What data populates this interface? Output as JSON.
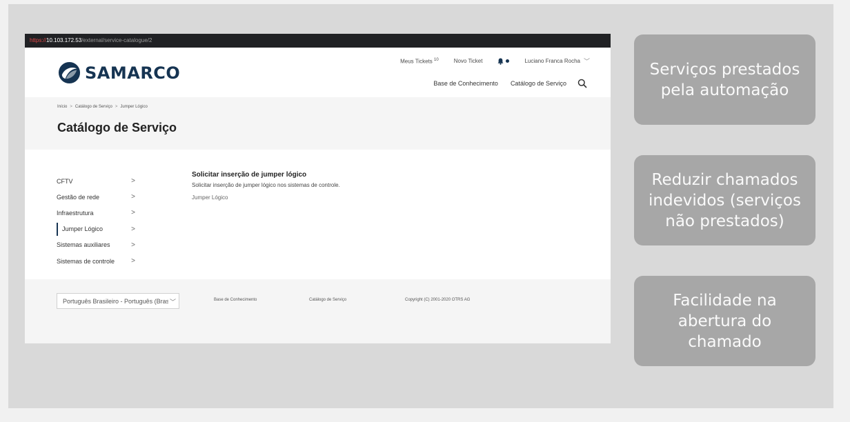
{
  "browser": {
    "url_protocol": "https://",
    "url_host": "10.103.172.53",
    "url_path": "/external/service-catalogue/2"
  },
  "brand": {
    "logo_text": "SAMARCO",
    "color": "#163452"
  },
  "topnav": {
    "my_tickets": "Meus Tickets",
    "my_tickets_count": "10",
    "new_ticket": "Novo Ticket",
    "user_name": "Luciano Franca Rocha"
  },
  "mainnav": {
    "knowledge_base": "Base de Conhecimento",
    "service_catalog": "Catálogo de Serviço"
  },
  "breadcrumb": {
    "items": [
      "Início",
      "Catálogo de Serviço",
      "Jumper Lógico"
    ],
    "separator": ">"
  },
  "page_title": "Catálogo de Serviço",
  "categories": {
    "arrow": ">",
    "items": [
      {
        "label": "CFTV"
      },
      {
        "label": "Gestão de rede"
      },
      {
        "label": "Infraestrutura"
      },
      {
        "label": "Jumper Lógico"
      },
      {
        "label": "Sistemas auxiliares"
      },
      {
        "label": "Sistemas de controle"
      }
    ]
  },
  "service": {
    "title": "Solicitar inserção de jumper lógico",
    "description": "Solicitar inserção de jumper lógico nos sistemas de controle.",
    "category_link": "Jumper Lógico"
  },
  "footer": {
    "language": "Português Brasileiro - Português (Brasil)",
    "knowledge_base": "Base de Conhecimento",
    "service_catalog": "Catálogo de Serviço",
    "copyright": "Copyright (C) 2001-2020 OTRS AG"
  },
  "callouts": [
    "Serviços prestados pela automação",
    "Reduzir chamados indevidos (serviços não prestados)",
    "Facilidade na abertura do chamado"
  ]
}
